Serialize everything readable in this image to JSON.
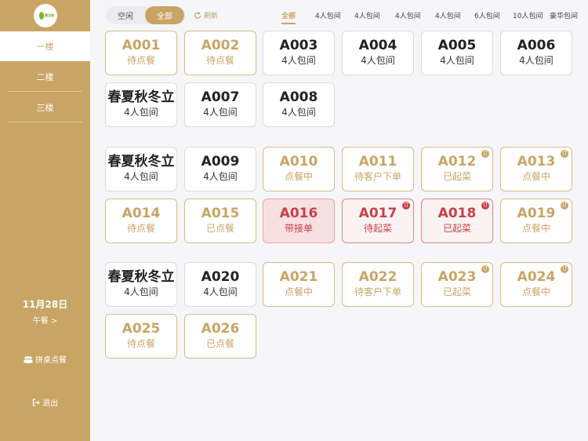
{
  "sidebar": {
    "logo_text": "腾龙阁",
    "floors": [
      {
        "label": "一楼"
      },
      {
        "label": "二楼"
      },
      {
        "label": "三楼"
      }
    ],
    "date": "11月28日",
    "meal": "午餐 >",
    "share_label": "拼桌点餐",
    "exit_label": "退出"
  },
  "topbar": {
    "seg_idle": "空闲",
    "seg_all": "全部",
    "refresh": "刷新",
    "filters": [
      "全部",
      "4人包间",
      "4人包间",
      "4人包间",
      "4人包间",
      "6人包间",
      "10人包间",
      "豪华包间"
    ]
  },
  "colors": {
    "gold": "#c8a564",
    "red": "#c9404a",
    "sidebar_bg": "#c8a564"
  },
  "cards": [
    {
      "name": "A001",
      "status": "待点餐"
    },
    {
      "name": "A002",
      "status": "待点餐"
    },
    {
      "name": "A003",
      "status": "4人包间"
    },
    {
      "name": "A004",
      "status": "4人包间"
    },
    {
      "name": "A005",
      "status": "4人包间"
    },
    {
      "name": "A006",
      "status": "4人包间"
    },
    {
      "name": "春夏秋冬立",
      "status": "4人包间"
    },
    {
      "name": "A007",
      "status": "4人包间"
    },
    {
      "name": "A008",
      "status": "4人包间"
    },
    {
      "name": "春夏秋冬立",
      "status": "4人包间"
    },
    {
      "name": "A009",
      "status": "4人包间"
    },
    {
      "name": "A010",
      "status": "点餐中"
    },
    {
      "name": "A011",
      "status": "待客户下单"
    },
    {
      "name": "A012",
      "status": "已起菜",
      "badge": "订"
    },
    {
      "name": "A013",
      "status": "点餐中",
      "badge": "订"
    },
    {
      "name": "A014",
      "status": "待点餐"
    },
    {
      "name": "A015",
      "status": "已点餐"
    },
    {
      "name": "A016",
      "status": "带接单"
    },
    {
      "name": "A017",
      "status": "待起菜",
      "badge": "订"
    },
    {
      "name": "A018",
      "status": "已起菜",
      "badge": "订"
    },
    {
      "name": "A019",
      "status": "点餐中",
      "badge": "订"
    },
    {
      "name": "春夏秋冬立",
      "status": "4人包间"
    },
    {
      "name": "A020",
      "status": "4人包间"
    },
    {
      "name": "A021",
      "status": "点餐中"
    },
    {
      "name": "A022",
      "status": "待客户下单"
    },
    {
      "name": "A023",
      "status": "已起菜",
      "badge": "订"
    },
    {
      "name": "A024",
      "status": "点餐中",
      "badge": "订"
    },
    {
      "name": "A025",
      "status": "待点餐"
    },
    {
      "name": "A026",
      "status": "已点餐"
    }
  ]
}
